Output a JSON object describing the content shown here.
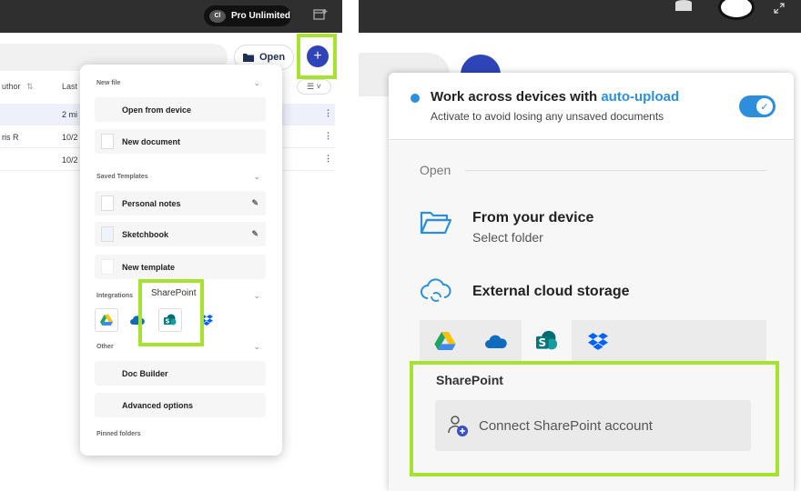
{
  "left_panel": {
    "topbar": {
      "plan_label": "Pro Unlimited",
      "logo_text": "Cl"
    },
    "toolbar": {
      "open_label": "Open",
      "plus_label": "+"
    },
    "table": {
      "headers": [
        "uthor",
        "Last"
      ],
      "rows": [
        {
          "author": "",
          "last": "2 mi"
        },
        {
          "author": "ris R",
          "last": "10/2"
        },
        {
          "author": "",
          "last": "10/2"
        }
      ]
    },
    "menu": {
      "new_file_label": "New file",
      "new_file_items": [
        "Open from device",
        "New document"
      ],
      "saved_templates_label": "Saved Templates",
      "template_items": [
        "Personal notes",
        "Sketchbook",
        "New template"
      ],
      "integrations_label": "Integrations",
      "integrations_tooltip": "SharePoint",
      "integration_icons": [
        "google-drive-icon",
        "onedrive-icon",
        "sharepoint-icon",
        "dropbox-icon"
      ],
      "other_label": "Other",
      "other_items": [
        "Doc Builder",
        "Advanced options"
      ],
      "pinned_label": "Pinned folders"
    }
  },
  "right_panel": {
    "banner": {
      "title_prefix": "Work across devices with ",
      "title_highlight": "auto-upload",
      "subtitle": "Activate to avoid losing any unsaved documents",
      "toggle_on": true
    },
    "open_section_label": "Open",
    "device": {
      "title": "From your device",
      "subtitle": "Select folder"
    },
    "cloud": {
      "title": "External cloud storage"
    },
    "cloud_tabs": [
      "google-drive-icon",
      "onedrive-icon",
      "sharepoint-icon",
      "dropbox-icon"
    ],
    "active_tab": "sharepoint-icon",
    "sharepoint_label": "SharePoint",
    "connect_label": "Connect SharePoint account"
  },
  "colors": {
    "accent_blue": "#2d8fdc",
    "plus_blue": "#2e44b8",
    "highlight_green": "#a6e22e"
  }
}
